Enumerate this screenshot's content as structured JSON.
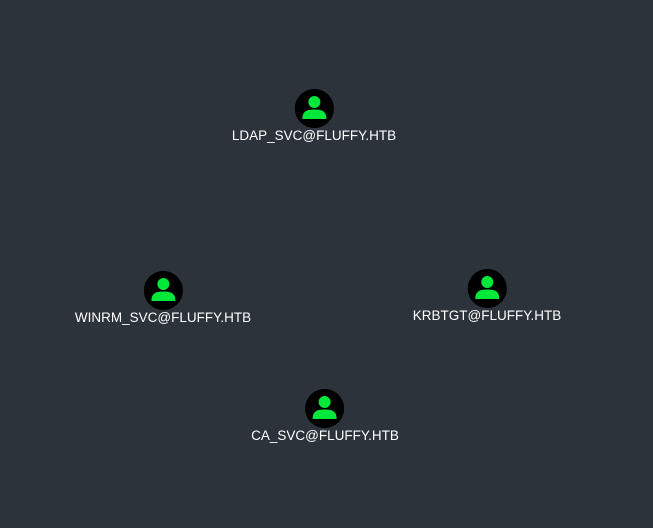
{
  "graph": {
    "background": "#2d333b",
    "node_color": "#00e83a",
    "node_ring_color": "#000000",
    "nodes": [
      {
        "label": "LDAP_SVC@FLUFFY.HTB",
        "icon": "user-icon"
      },
      {
        "label": "WINRM_SVC@FLUFFY.HTB",
        "icon": "user-icon"
      },
      {
        "label": "KRBTGT@FLUFFY.HTB",
        "icon": "user-icon"
      },
      {
        "label": "CA_SVC@FLUFFY.HTB",
        "icon": "user-icon"
      }
    ]
  }
}
